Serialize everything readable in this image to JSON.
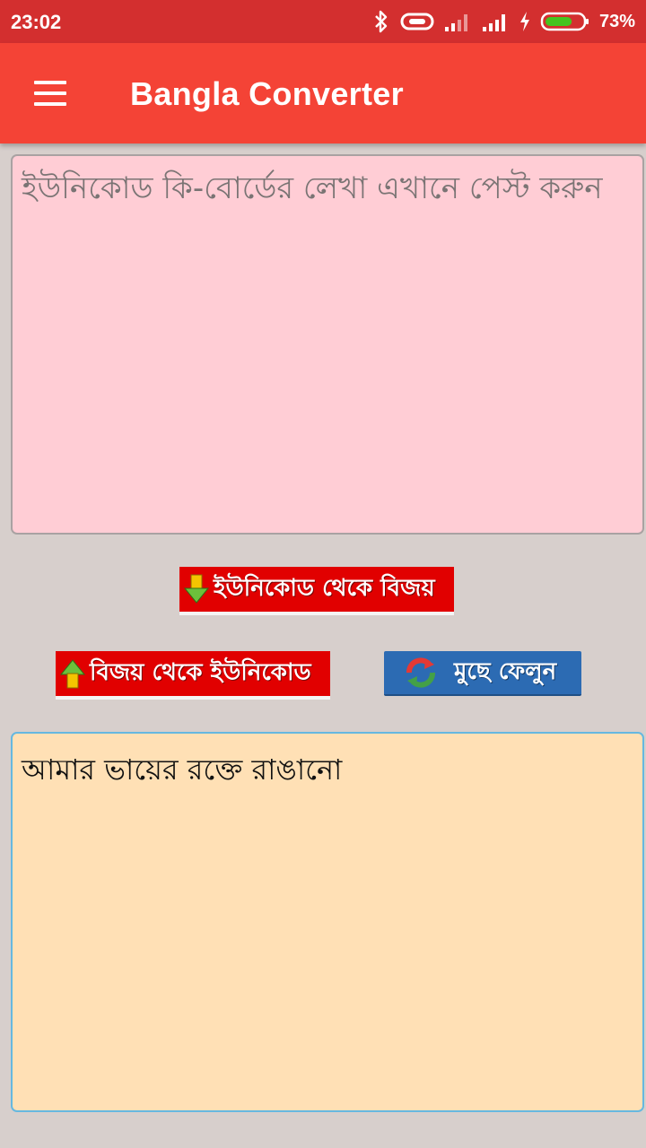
{
  "status_bar": {
    "time": "23:02",
    "battery_percent": "73%",
    "battery_level": 0.73,
    "icons": [
      "bluetooth-icon",
      "link-icon",
      "signal-icon",
      "signal-icon",
      "charging-icon",
      "battery-icon"
    ]
  },
  "app_bar": {
    "title": "Bangla Converter",
    "menu_icon": "hamburger-menu-icon"
  },
  "input": {
    "placeholder": "ইউনিকোড কি-বোর্ডের লেখা এখানে পেস্ট করুন",
    "value": ""
  },
  "buttons": {
    "unicode_to_bijoy": "ইউনিকোড থেকে বিজয়",
    "bijoy_to_unicode": "বিজয় থেকে ইউনিকোড",
    "clear": "মুছে ফেলুন"
  },
  "output": {
    "value": "আমার ভায়ের রক্তে রাঙানো"
  },
  "colors": {
    "status_bar": "#d32f2f",
    "app_bar": "#f44336",
    "input_bg": "#ffcdd5",
    "output_bg": "#ffe0b5",
    "button_red": "#e10000",
    "button_blue": "#2c6bb3"
  }
}
